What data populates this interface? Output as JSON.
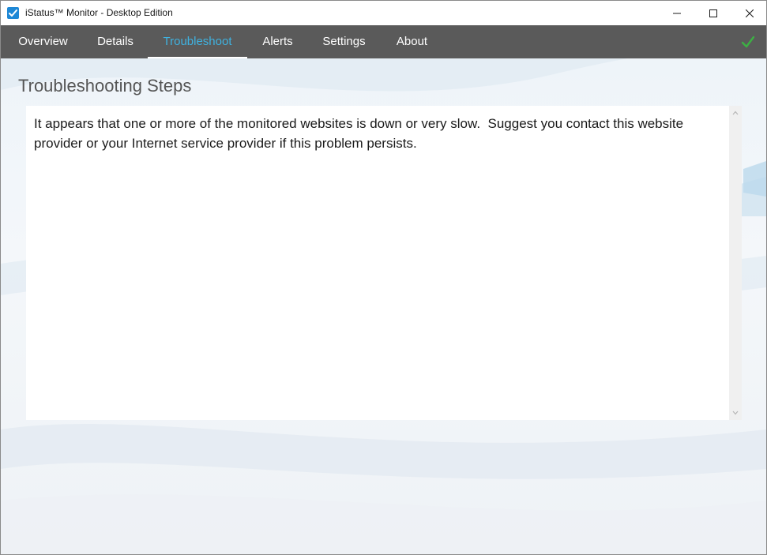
{
  "window": {
    "title": "iStatus™ Monitor - Desktop Edition",
    "controls": {
      "minimize_icon": "minimize-icon",
      "maximize_icon": "maximize-icon",
      "close_icon": "close-icon"
    }
  },
  "nav": {
    "tabs": [
      {
        "label": "Overview",
        "active": false
      },
      {
        "label": "Details",
        "active": false
      },
      {
        "label": "Troubleshoot",
        "active": true
      },
      {
        "label": "Alerts",
        "active": false
      },
      {
        "label": "Settings",
        "active": false
      },
      {
        "label": "About",
        "active": false
      }
    ],
    "status_icon": "checkmark-icon",
    "status_color": "#3cb043"
  },
  "main": {
    "section_title": "Troubleshooting Steps",
    "message": "It appears that one or more of the monitored websites is down or very slow.  Suggest you contact this website provider or your Internet service provider if this problem persists."
  },
  "colors": {
    "nav_background": "#5a5a5a",
    "active_tab": "#3fb2e0",
    "app_icon": "#1e88d6"
  }
}
